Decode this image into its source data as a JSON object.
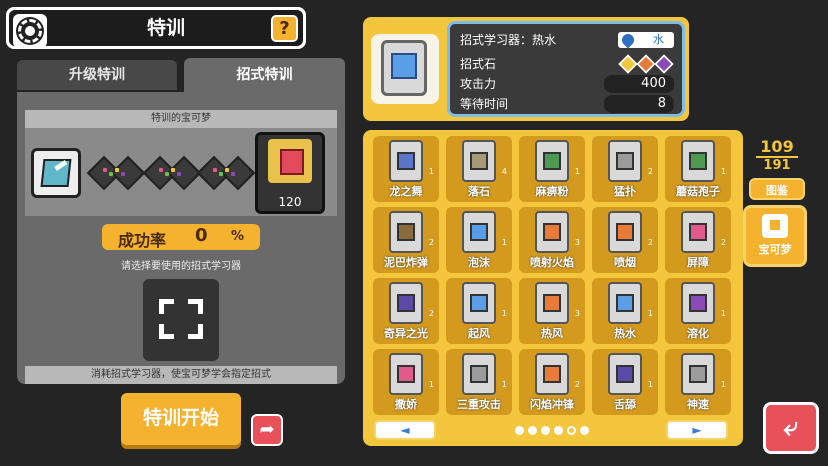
{
  "header": {
    "title": "特训",
    "help_label": "?"
  },
  "tabs": [
    {
      "label": "升级特训",
      "active": false
    },
    {
      "label": "招式特训",
      "active": true
    }
  ],
  "left": {
    "pokemon_section_label": "特训的宝可梦",
    "pokemon_level": "120",
    "success_rate_label": "成功率",
    "success_rate_value": "0",
    "success_rate_unit": "%",
    "select_prompt": "请选择要使用的招式学习器",
    "bottom_note": "消耗招式学习器，使宝可梦学会指定招式",
    "start_button": "特训开始",
    "share_icon": "arrow-share-icon"
  },
  "info": {
    "name": "招式学习器：热水",
    "type": "水",
    "stone_label": "招式石",
    "attack_label": "攻击力",
    "attack_value": "400",
    "wait_label": "等待时间",
    "wait_value": "8",
    "colors": {
      "accent": "#f4c63d",
      "border": "#7fbde6"
    }
  },
  "grid": {
    "items": [
      {
        "name": "龙之舞",
        "count": "1",
        "core": "#5b76c9"
      },
      {
        "name": "落石",
        "count": "4",
        "core": "#a89a74"
      },
      {
        "name": "麻痹粉",
        "count": "1",
        "core": "#4f9a52"
      },
      {
        "name": "猛扑",
        "count": "2",
        "core": "#9b9b9b"
      },
      {
        "name": "蘑菇孢子",
        "count": "1",
        "core": "#4f9a52"
      },
      {
        "name": "泥巴炸弹",
        "count": "2",
        "core": "#8a6b3e"
      },
      {
        "name": "泡沫",
        "count": "1",
        "core": "#5a9ee8"
      },
      {
        "name": "喷射火焰",
        "count": "3",
        "core": "#e87a3a"
      },
      {
        "name": "喷烟",
        "count": "2",
        "core": "#e87a3a"
      },
      {
        "name": "屏障",
        "count": "2",
        "core": "#e05a8a"
      },
      {
        "name": "奇异之光",
        "count": "2",
        "core": "#5b4aa8"
      },
      {
        "name": "起风",
        "count": "1",
        "core": "#5a9ee8"
      },
      {
        "name": "热风",
        "count": "3",
        "core": "#e87a3a"
      },
      {
        "name": "热水",
        "count": "1",
        "core": "#5a9ee8"
      },
      {
        "name": "溶化",
        "count": "1",
        "core": "#8a4ab8"
      },
      {
        "name": "撒娇",
        "count": "1",
        "core": "#e05a8a"
      },
      {
        "name": "三重攻击",
        "count": "1",
        "core": "#9b9b9b"
      },
      {
        "name": "闪焰冲锋",
        "count": "2",
        "core": "#e87a3a"
      },
      {
        "name": "舌舔",
        "count": "1",
        "core": "#5b4aa8"
      },
      {
        "name": "神速",
        "count": "1",
        "core": "#9b9b9b"
      }
    ],
    "prev_label": "◄",
    "next_label": "►",
    "dots": 6,
    "active_dot": 4
  },
  "side": {
    "count_current": "109",
    "count_total": "191",
    "dex_label": "图鉴",
    "pokemon_label": "宝可梦",
    "back_label": "⤶"
  }
}
